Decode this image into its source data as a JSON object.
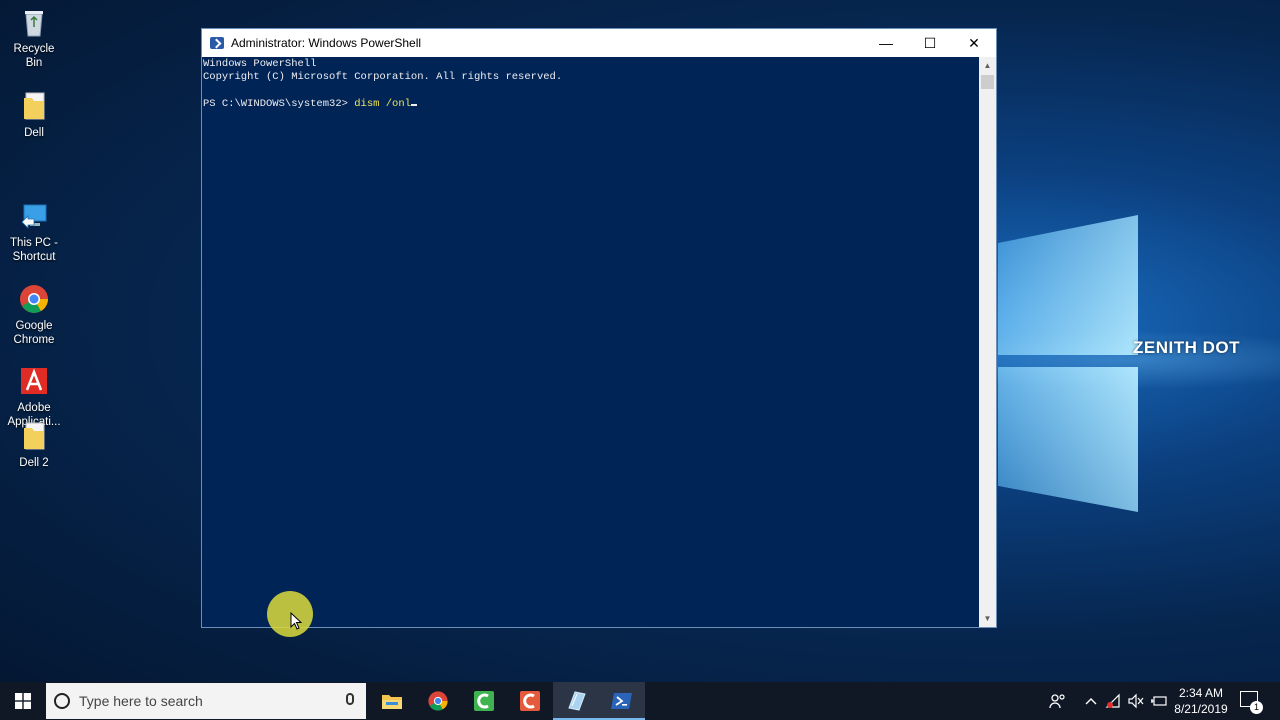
{
  "desktop": {
    "icons": [
      {
        "label": "Recycle Bin",
        "icon": "recycle-bin-icon"
      },
      {
        "label": "Dell",
        "icon": "folder-icon"
      },
      {
        "label": "This PC -\nShortcut",
        "icon": "computer-icon"
      },
      {
        "label": "Google\nChrome",
        "icon": "chrome-icon"
      },
      {
        "label": "Adobe\nApplicati...",
        "icon": "adobe-icon"
      },
      {
        "label": "Dell 2",
        "icon": "folder-icon"
      }
    ],
    "watermark": "ZENITH DOT"
  },
  "window": {
    "title": "Administrator: Windows PowerShell",
    "buttons": {
      "minimize": "—",
      "maximize": "☐",
      "close": "✕"
    },
    "console": {
      "line1": "Windows PowerShell",
      "line2": "Copyright (C) Microsoft Corporation. All rights reserved.",
      "prompt": "PS C:\\WINDOWS\\system32> ",
      "command": "dism /onl"
    }
  },
  "taskbar": {
    "search_placeholder": "Type here to search",
    "apps": [
      "file-explorer-icon",
      "chrome-icon",
      "camtasia-icon",
      "camtasia-recorder-icon",
      "notepad-icon",
      "powershell-icon"
    ],
    "clock_time": "2:34 AM",
    "clock_date": "8/21/2019",
    "notification_count": "1"
  },
  "colors": {
    "console_bg": "#012456",
    "console_text": "#eeedf0",
    "command_text": "#f0e35a",
    "taskbar_bg": "#101826"
  }
}
